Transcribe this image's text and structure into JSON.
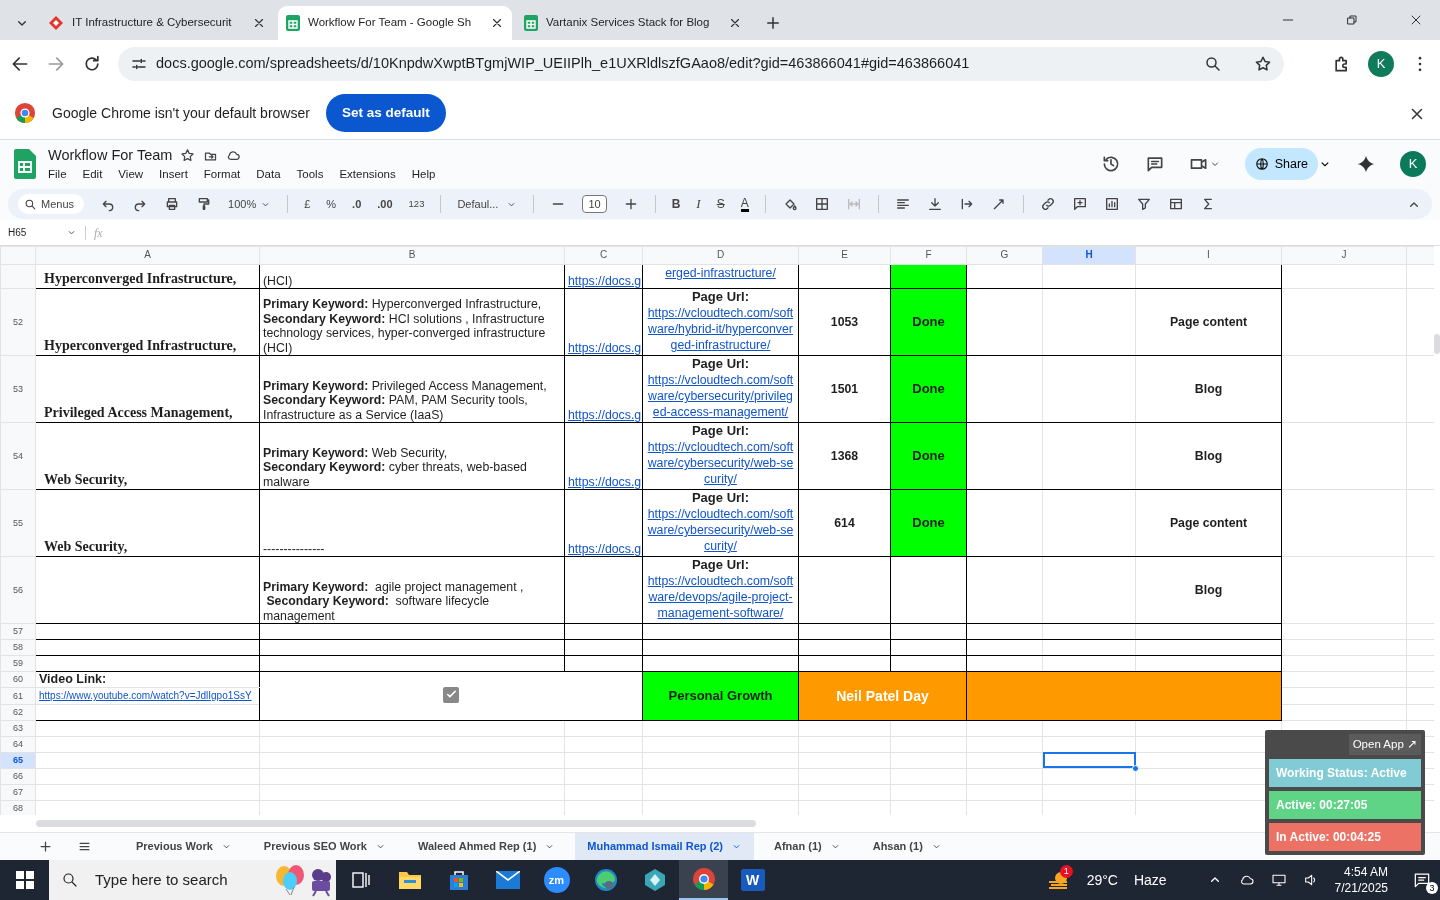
{
  "browser": {
    "tabs": [
      {
        "title": "IT Infrastructure & Cybersecurit",
        "selected": false,
        "kind": "site"
      },
      {
        "title": "Workflow For Team - Google Sh",
        "selected": true,
        "kind": "sheets"
      },
      {
        "title": "Vartanix Services Stack for Blog",
        "selected": false,
        "kind": "sheets"
      }
    ],
    "url": "docs.google.com/spreadsheets/d/10KnpdwXwptBTgmjWIP_UEIIPlh_e1UXRldlszfGAao8/edit?gid=463866041#gid=463866041",
    "profile": "K",
    "infobar": {
      "message": "Google Chrome isn't your default browser",
      "button": "Set as default"
    }
  },
  "doc": {
    "title": "Workflow For Team",
    "menu": [
      "File",
      "Edit",
      "View",
      "Insert",
      "Format",
      "Data",
      "Tools",
      "Extensions",
      "Help"
    ],
    "share": "Share",
    "avatar": "K"
  },
  "toolbar": {
    "search": "Menus",
    "zoom": "100%",
    "currency": "£",
    "percent": "%",
    "decrease_decimal": ".0",
    "increase_decimal": ".00",
    "number_format": "123",
    "font": "Defaul...",
    "font_size": "10",
    "bold": "B",
    "italic": "I",
    "strikethrough": "S",
    "text_color": "A"
  },
  "formula_bar": {
    "cell": "H65",
    "fx": "fx"
  },
  "columns": [
    {
      "label": "A",
      "selected": false
    },
    {
      "label": "B",
      "selected": false
    },
    {
      "label": "C",
      "selected": false
    },
    {
      "label": "D",
      "selected": false
    },
    {
      "label": "E",
      "selected": false
    },
    {
      "label": "F",
      "selected": false
    },
    {
      "label": "G",
      "selected": false
    },
    {
      "label": "H",
      "selected": true
    },
    {
      "label": "I",
      "selected": false
    },
    {
      "label": "J",
      "selected": false
    }
  ],
  "rows": [
    {
      "a": "Hyperconverged Infrastructure,",
      "b": "(HCI)",
      "c": "https://docs.g",
      "d_url": "erged-infrastructure/",
      "done": true
    },
    {
      "num": "52",
      "a": "Hyperconverged Infrastructure,",
      "b": "**Primary Keyword:** Hyperconverged Infrastructure,\n**Secondary Keyword:** HCI solutions , Infrastructure technology services, hyper-converged infrastructure (HCI)",
      "c": "https://docs.g",
      "d_label": "Page Url:",
      "d_url": "https://vcloudtech.com/software/hybrid-it/hyperconverged-infrastructure/",
      "e": "1053",
      "f": "Done",
      "done": true,
      "i": "Page content"
    },
    {
      "num": "53",
      "a": "Privileged Access Management,",
      "b": "**Primary Keyword:** Privileged Access Management,\n**Secondary Keyword:** PAM, PAM Security tools, Infrastructure as a Service (IaaS)",
      "c": "https://docs.g",
      "d_label": "Page Url:",
      "d_url": "https://vcloudtech.com/software/cybersecurity/privileged-access-management/",
      "e": "1501",
      "f": "Done",
      "done": true,
      "i": "Blog"
    },
    {
      "num": "54",
      "a": "Web Security,",
      "b": "**Primary Keyword:** Web Security,\n**Secondary Keyword:** cyber threats, web-based malware",
      "c": "https://docs.g",
      "d_label": "Page Url:",
      "d_url": "https://vcloudtech.com/software/cybersecurity/web-security/",
      "e": "1368",
      "f": "Done",
      "done": true,
      "i": "Blog"
    },
    {
      "num": "55",
      "a": "Web Security,",
      "b": "---------------",
      "c": "https://docs.g",
      "d_label": "Page Url:",
      "d_url": "https://vcloudtech.com/software/cybersecurity/web-security/",
      "e": "614",
      "f": "Done",
      "done": true,
      "i": "Page content"
    },
    {
      "num": "56",
      "b": "**Primary Keyword:**  agile project management ,\n **Secondary Keyword:**  software lifecycle management",
      "d_label": "Page Url:",
      "d_url": "https://vcloudtech.com/software/devops/agile-project-management-software/",
      "done": false,
      "i": "Blog"
    }
  ],
  "empty_rows": [
    "57",
    "58",
    "59"
  ],
  "block": {
    "rows": [
      "60",
      "61",
      "62"
    ],
    "video_label": "Video Link:",
    "video_url": "https://www.youtube.com/watch?v=JdlIgpo1SsY",
    "checked": true,
    "growth": "Personal Growth",
    "event": "Neil Patel Day"
  },
  "blank_rows": [
    {
      "num": "63",
      "selected": false
    },
    {
      "num": "64",
      "selected": false
    },
    {
      "num": "65",
      "selected": true
    },
    {
      "num": "66",
      "selected": false
    },
    {
      "num": "67",
      "selected": false
    },
    {
      "num": "68",
      "selected": false
    }
  ],
  "sheet_tabs": [
    {
      "label": "Previous Work",
      "selected": false
    },
    {
      "label": "Previous SEO Work",
      "selected": false
    },
    {
      "label": "Waleed Ahmed Rep (1)",
      "selected": false
    },
    {
      "label": "Muhammad Ismail Rep (2)",
      "selected": true
    },
    {
      "label": "Afnan (1)",
      "selected": false
    },
    {
      "label": "Ahsan (1)",
      "selected": false
    }
  ],
  "widget": {
    "open_app": "Open App ↗",
    "statuses": [
      {
        "text": "Working Status: Active",
        "color": "#80cbd4"
      },
      {
        "text": "Active: 00:27:05",
        "color": "#5fd487"
      },
      {
        "text": "In Active: 00:04:25",
        "color": "#ec7265"
      }
    ]
  },
  "taskbar": {
    "search": "Type here to search",
    "apps": [
      {
        "kind": "taskview",
        "active": false
      },
      {
        "kind": "explorer",
        "active": false
      },
      {
        "kind": "store",
        "active": false
      },
      {
        "kind": "mail",
        "active": false
      },
      {
        "kind": "zoom",
        "label": "zm",
        "active": false
      },
      {
        "kind": "edge",
        "active": false
      },
      {
        "kind": "app",
        "active": false
      },
      {
        "kind": "chrome",
        "active": true
      },
      {
        "kind": "word",
        "label": "W",
        "active": false
      }
    ],
    "weather_badge": "1",
    "temperature": "29°C",
    "condition": "Haze",
    "time": "4:54 AM",
    "date": "7/21/2025",
    "notifications": "3"
  }
}
